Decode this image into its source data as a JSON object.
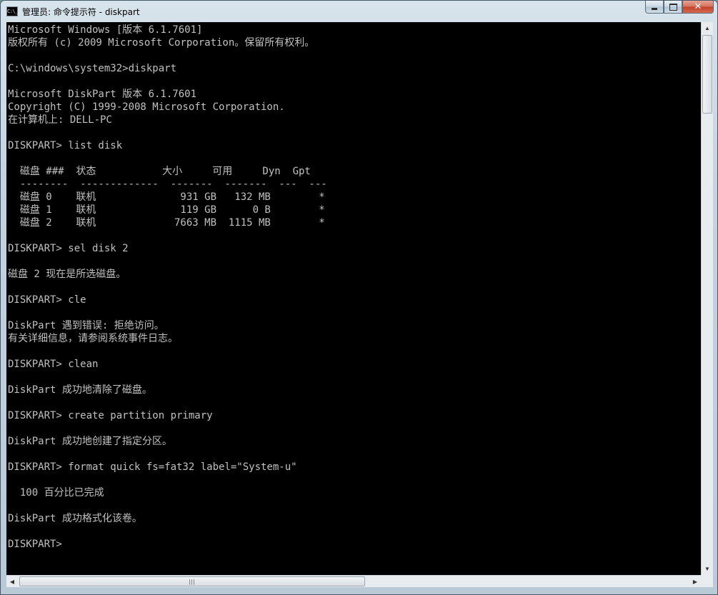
{
  "window": {
    "title": "管理员: 命令提示符 - diskpart",
    "icon_label": "C:\\_",
    "icon": "console-icon",
    "controls": [
      "minimize-icon",
      "maximize-icon",
      "close-icon"
    ]
  },
  "console": {
    "lines": [
      "Microsoft Windows [版本 6.1.7601]",
      "版权所有 (c) 2009 Microsoft Corporation。保留所有权利。",
      "",
      "C:\\windows\\system32>diskpart",
      "",
      "Microsoft DiskPart 版本 6.1.7601",
      "Copyright (C) 1999-2008 Microsoft Corporation.",
      "在计算机上: DELL-PC",
      "",
      "DISKPART> list disk",
      "",
      "  磁盘 ###  状态           大小     可用     Dyn  Gpt",
      "  --------  -------------  -------  -------  ---  ---",
      "  磁盘 0    联机              931 GB   132 MB        *",
      "  磁盘 1    联机              119 GB      0 B        *",
      "  磁盘 2    联机             7663 MB  1115 MB        *",
      "",
      "DISKPART> sel disk 2",
      "",
      "磁盘 2 现在是所选磁盘。",
      "",
      "DISKPART> cle",
      "",
      "DiskPart 遇到错误: 拒绝访问。",
      "有关详细信息，请参阅系统事件日志。",
      "",
      "DISKPART> clean",
      "",
      "DiskPart 成功地清除了磁盘。",
      "",
      "DISKPART> create partition primary",
      "",
      "DiskPart 成功地创建了指定分区。",
      "",
      "DISKPART> format quick fs=fat32 label=\"System-u\"",
      "",
      "  100 百分比已完成",
      "",
      "DiskPart 成功格式化该卷。",
      "",
      "DISKPART> "
    ]
  },
  "scrollbars": {
    "up_arrow": "▲",
    "down_arrow": "▼",
    "left_arrow": "◀",
    "right_arrow": "▶",
    "grip": "|||"
  }
}
